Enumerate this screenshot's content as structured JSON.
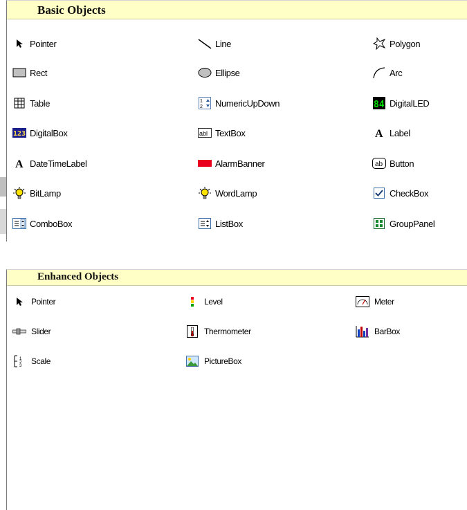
{
  "basic_objects": {
    "title": "Basic Objects",
    "items": [
      {
        "label": "Pointer",
        "icon": "pointer-arrow-icon"
      },
      {
        "label": "Line",
        "icon": "line-icon"
      },
      {
        "label": "Polygon",
        "icon": "polygon-icon"
      },
      {
        "label": "Rect",
        "icon": "rectangle-icon"
      },
      {
        "label": "Ellipse",
        "icon": "ellipse-icon"
      },
      {
        "label": "Arc",
        "icon": "arc-icon"
      },
      {
        "label": "Table",
        "icon": "table-grid-icon"
      },
      {
        "label": "NumericUpDown",
        "icon": "numeric-updown-icon"
      },
      {
        "label": "DigitalLED",
        "icon": "digital-led-icon"
      },
      {
        "label": "DigitalBox",
        "icon": "digital-box-icon"
      },
      {
        "label": "TextBox",
        "icon": "textbox-icon"
      },
      {
        "label": "Label",
        "icon": "label-a-icon"
      },
      {
        "label": "DateTimeLabel",
        "icon": "label-a-icon"
      },
      {
        "label": "AlarmBanner",
        "icon": "alarm-banner-icon"
      },
      {
        "label": "Button",
        "icon": "button-ab-icon"
      },
      {
        "label": "BitLamp",
        "icon": "lamp-bulb-icon"
      },
      {
        "label": "WordLamp",
        "icon": "lamp-bulb-icon"
      },
      {
        "label": "CheckBox",
        "icon": "checkbox-icon"
      },
      {
        "label": "ComboBox",
        "icon": "combobox-icon"
      },
      {
        "label": "ListBox",
        "icon": "listbox-icon"
      },
      {
        "label": "GroupPanel",
        "icon": "group-panel-icon"
      }
    ]
  },
  "enhanced_objects": {
    "title": "Enhanced Objects",
    "items": [
      {
        "label": "Pointer",
        "icon": "pointer-arrow-icon"
      },
      {
        "label": "Level",
        "icon": "level-icon"
      },
      {
        "label": "Meter",
        "icon": "meter-icon"
      },
      {
        "label": "Slider",
        "icon": "slider-icon"
      },
      {
        "label": "Thermometer",
        "icon": "thermometer-icon"
      },
      {
        "label": "BarBox",
        "icon": "bar-chart-icon"
      },
      {
        "label": "Scale",
        "icon": "scale-icon"
      },
      {
        "label": "PictureBox",
        "icon": "picture-icon"
      }
    ]
  },
  "colors": {
    "header_bg": "#ffffc6",
    "led_green": "#00e000",
    "alarm_red": "#e8001c"
  }
}
